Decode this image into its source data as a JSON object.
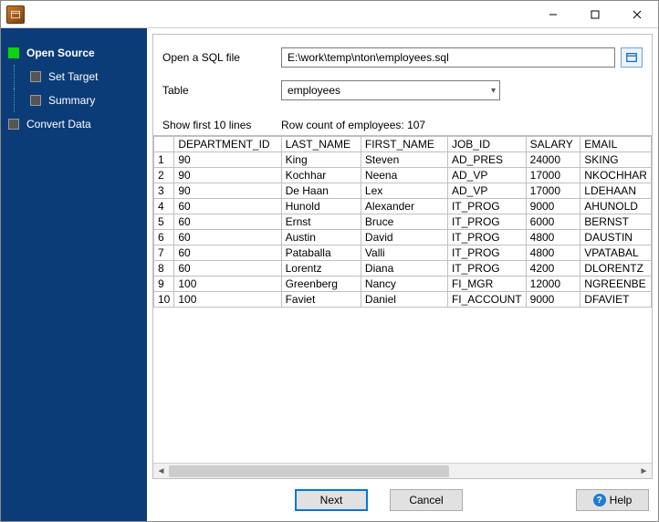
{
  "titlebar": {
    "title": ""
  },
  "sidebar": {
    "items": [
      {
        "label": "Open Source",
        "active": true,
        "sub": false
      },
      {
        "label": "Set Target",
        "active": false,
        "sub": true
      },
      {
        "label": "Summary",
        "active": false,
        "sub": true
      },
      {
        "label": "Convert Data",
        "active": false,
        "sub": false
      }
    ]
  },
  "form": {
    "open_label": "Open a SQL file",
    "file_path": "E:\\work\\temp\\nton\\employees.sql",
    "table_label": "Table",
    "table_selected": "employees"
  },
  "info": {
    "show_first": "Show first 10 lines",
    "row_count": "Row count of employees: 107"
  },
  "grid": {
    "columns": [
      "DEPARTMENT_ID",
      "LAST_NAME",
      "FIRST_NAME",
      "JOB_ID",
      "SALARY",
      "EMAIL"
    ],
    "rows": [
      [
        "90",
        "King",
        "Steven",
        "AD_PRES",
        "24000",
        "SKING"
      ],
      [
        "90",
        "Kochhar",
        "Neena",
        "AD_VP",
        "17000",
        "NKOCHHAR"
      ],
      [
        "90",
        "De Haan",
        "Lex",
        "AD_VP",
        "17000",
        "LDEHAAN"
      ],
      [
        "60",
        "Hunold",
        "Alexander",
        "IT_PROG",
        "9000",
        "AHUNOLD"
      ],
      [
        "60",
        "Ernst",
        "Bruce",
        "IT_PROG",
        "6000",
        "BERNST"
      ],
      [
        "60",
        "Austin",
        "David",
        "IT_PROG",
        "4800",
        "DAUSTIN"
      ],
      [
        "60",
        "Pataballa",
        "Valli",
        "IT_PROG",
        "4800",
        "VPATABAL"
      ],
      [
        "60",
        "Lorentz",
        "Diana",
        "IT_PROG",
        "4200",
        "DLORENTZ"
      ],
      [
        "100",
        "Greenberg",
        "Nancy",
        "FI_MGR",
        "12000",
        "NGREENBE"
      ],
      [
        "100",
        "Faviet",
        "Daniel",
        "FI_ACCOUNT",
        "9000",
        "DFAVIET"
      ]
    ]
  },
  "footer": {
    "next": "Next",
    "cancel": "Cancel",
    "help": "Help"
  }
}
